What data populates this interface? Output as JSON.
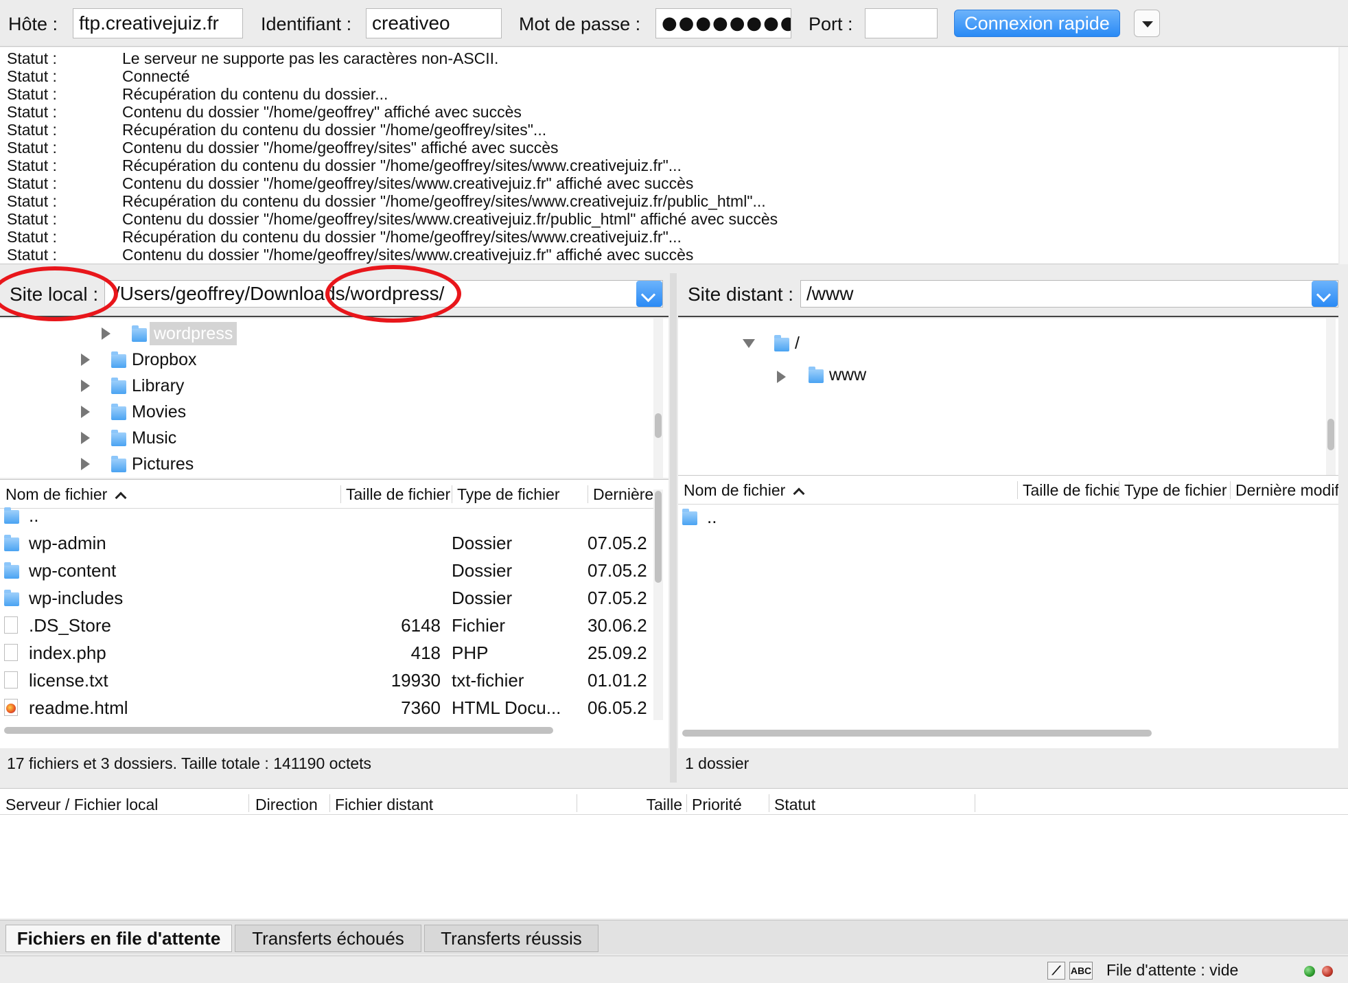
{
  "quick_connect": {
    "host_label": "Hôte :",
    "host_value": "ftp.creativejuiz.fr",
    "user_label": "Identifiant :",
    "user_value": "creativeo",
    "password_label": "Mot de passe :",
    "password_value": "●●●●●●●●●●●",
    "port_label": "Port :",
    "port_value": "",
    "connect_label": "Connexion rapide"
  },
  "log": [
    {
      "type": "Statut :",
      "message": "Le serveur ne supporte pas les caractères non-ASCII."
    },
    {
      "type": "Statut :",
      "message": "Connecté"
    },
    {
      "type": "Statut :",
      "message": "Récupération du contenu du dossier..."
    },
    {
      "type": "Statut :",
      "message": "Contenu du dossier \"/home/geoffrey\" affiché avec succès"
    },
    {
      "type": "Statut :",
      "message": "Récupération du contenu du dossier \"/home/geoffrey/sites\"..."
    },
    {
      "type": "Statut :",
      "message": "Contenu du dossier \"/home/geoffrey/sites\" affiché avec succès"
    },
    {
      "type": "Statut :",
      "message": "Récupération du contenu du dossier \"/home/geoffrey/sites/www.creativejuiz.fr\"..."
    },
    {
      "type": "Statut :",
      "message": "Contenu du dossier \"/home/geoffrey/sites/www.creativejuiz.fr\" affiché avec succès"
    },
    {
      "type": "Statut :",
      "message": "Récupération du contenu du dossier \"/home/geoffrey/sites/www.creativejuiz.fr/public_html\"..."
    },
    {
      "type": "Statut :",
      "message": "Contenu du dossier \"/home/geoffrey/sites/www.creativejuiz.fr/public_html\" affiché avec succès"
    },
    {
      "type": "Statut :",
      "message": "Récupération du contenu du dossier \"/home/geoffrey/sites/www.creativejuiz.fr\"..."
    },
    {
      "type": "Statut :",
      "message": "Contenu du dossier \"/home/geoffrey/sites/www.creativejuiz.fr\" affiché avec succès"
    }
  ],
  "local": {
    "label": "Site local :",
    "path": "/Users/geoffrey/Downloads/wordpress/",
    "tree": [
      {
        "name": "wordpress",
        "selected": true
      },
      {
        "name": "Dropbox",
        "selected": false
      },
      {
        "name": "Library",
        "selected": false
      },
      {
        "name": "Movies",
        "selected": false
      },
      {
        "name": "Music",
        "selected": false
      },
      {
        "name": "Pictures",
        "selected": false
      }
    ],
    "columns": [
      "Nom de fichier",
      "Taille de fichier",
      "Type de fichier",
      "Dernière modification"
    ],
    "files": [
      {
        "name": "..",
        "size": "",
        "type": "",
        "date": "",
        "icon": "folder-icon"
      },
      {
        "name": "wp-admin",
        "size": "",
        "type": "Dossier",
        "date": "07.05.2",
        "icon": "folder-icon"
      },
      {
        "name": "wp-content",
        "size": "",
        "type": "Dossier",
        "date": "07.05.2",
        "icon": "folder-icon"
      },
      {
        "name": "wp-includes",
        "size": "",
        "type": "Dossier",
        "date": "07.05.2",
        "icon": "folder-icon"
      },
      {
        "name": ".DS_Store",
        "size": "6148",
        "type": "Fichier",
        "date": "30.06.2",
        "icon": "file-icon"
      },
      {
        "name": "index.php",
        "size": "418",
        "type": "PHP",
        "date": "25.09.2",
        "icon": "file-icon"
      },
      {
        "name": "license.txt",
        "size": "19930",
        "type": "txt-fichier",
        "date": "01.01.2",
        "icon": "file-icon"
      },
      {
        "name": "readme.html",
        "size": "7360",
        "type": "HTML Docu...",
        "date": "06.05.2",
        "icon": "html-file-icon"
      }
    ],
    "status": "17 fichiers et 3 dossiers. Taille totale : 141190 octets"
  },
  "remote": {
    "label": "Site distant :",
    "path": "/www",
    "tree": [
      {
        "name": "/",
        "expanded": true
      },
      {
        "name": "www",
        "expanded": false
      }
    ],
    "columns": [
      "Nom de fichier",
      "Taille de fichier",
      "Type de fichier",
      "Dernière modification"
    ],
    "files": [
      {
        "name": "..",
        "icon": "folder-icon"
      }
    ],
    "status": "1 dossier"
  },
  "queue": {
    "columns": [
      "Serveur / Fichier local",
      "Direction",
      "Fichier distant",
      "Taille",
      "Priorité",
      "Statut"
    ]
  },
  "tabs": [
    {
      "label": "Fichiers en file d'attente",
      "active": true
    },
    {
      "label": "Transferts échoués",
      "active": false
    },
    {
      "label": "Transferts réussis",
      "active": false
    }
  ],
  "statusbar": {
    "queue_text": "File d'attente : vide",
    "binary_badge": "ABC"
  },
  "colors": {
    "accent": "#2a8af5",
    "annotation": "#e8161b",
    "led_green": "#2e9d2e",
    "led_red": "#c0392b"
  }
}
